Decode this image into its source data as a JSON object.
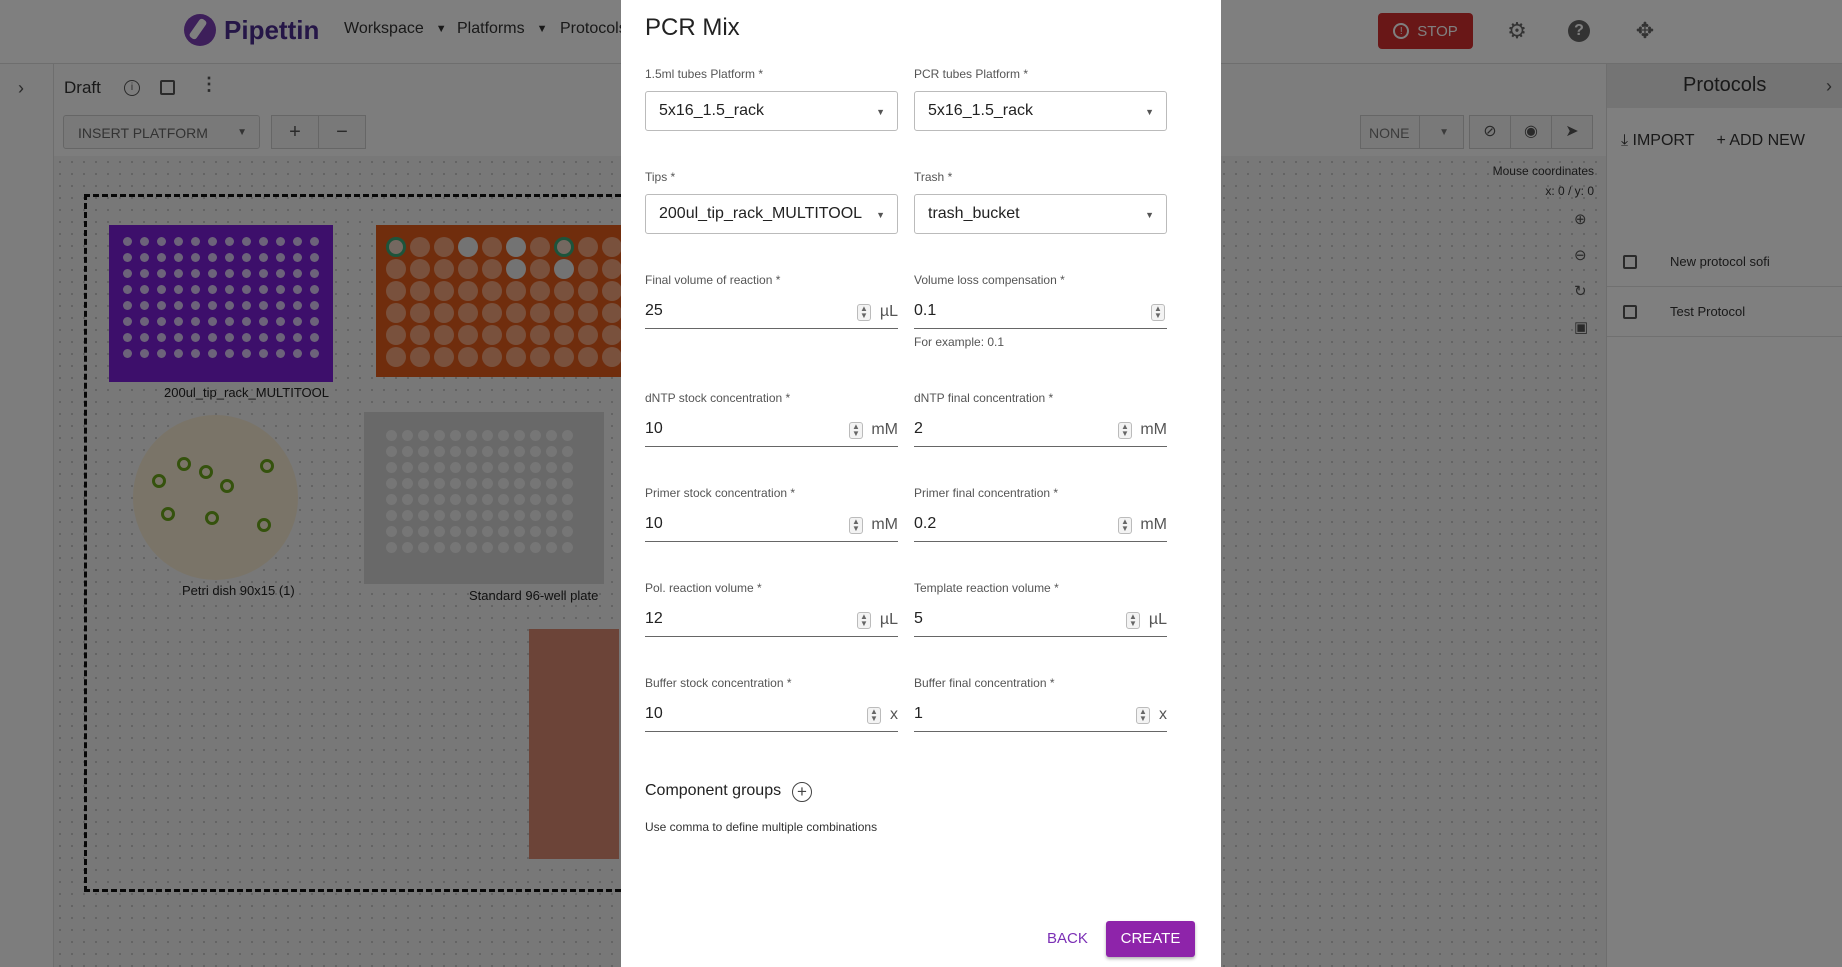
{
  "app": {
    "brand": "Pipettin",
    "nav": [
      "Workspace",
      "Platforms",
      "Protocols"
    ],
    "stop_label": "STOP"
  },
  "workspace": {
    "title": "Draft",
    "insert_platform_label": "INSERT PLATFORM",
    "plus_label": "+",
    "minus_label": "−",
    "selection_label": "NONE",
    "mouse_coords_label": "Mouse coordinates",
    "mouse_coords_value": "x: 0 / y: 0",
    "labware": [
      {
        "label": "200ul_tip_rack_MULTITOOL",
        "color": "#7b1fd6"
      },
      {
        "label": "Petri dish 90x15 (1)",
        "color": "#f4e9d0"
      },
      {
        "label": "Standard 96-well plate",
        "color": "#d3d3d3"
      },
      {
        "label": "",
        "color": "#e05a1a"
      },
      {
        "label": "",
        "color": "#d98870"
      }
    ]
  },
  "protocols_panel": {
    "title": "Protocols",
    "import_label": "IMPORT",
    "add_new_label": "ADD NEW",
    "items": [
      "New protocol sofi",
      "Test Protocol"
    ]
  },
  "modal": {
    "title": "PCR Mix",
    "tubes_platform": {
      "label": "1.5ml tubes Platform *",
      "value": "5x16_1.5_rack"
    },
    "pcr_tubes_platform": {
      "label": "PCR tubes Platform *",
      "value": "5x16_1.5_rack"
    },
    "tips": {
      "label": "Tips *",
      "value": "200ul_tip_rack_MULTITOOL"
    },
    "trash": {
      "label": "Trash *",
      "value": "trash_bucket"
    },
    "final_volume": {
      "label": "Final volume of reaction *",
      "value": "25",
      "unit": "µL"
    },
    "volume_loss": {
      "label": "Volume loss compensation *",
      "value": "0.1",
      "helper": "For example: 0.1"
    },
    "dntp_stock": {
      "label": "dNTP stock concentration *",
      "value": "10",
      "unit": "mM"
    },
    "dntp_final": {
      "label": "dNTP final concentration *",
      "value": "2",
      "unit": "mM"
    },
    "primer_stock": {
      "label": "Primer stock concentration *",
      "value": "10",
      "unit": "mM"
    },
    "primer_final": {
      "label": "Primer final concentration *",
      "value": "0.2",
      "unit": "mM"
    },
    "pol_volume": {
      "label": "Pol. reaction volume *",
      "value": "12",
      "unit": "µL"
    },
    "template_volume": {
      "label": "Template reaction volume *",
      "value": "5",
      "unit": "µL"
    },
    "buffer_stock": {
      "label": "Buffer stock concentration *",
      "value": "10",
      "unit": "x"
    },
    "buffer_final": {
      "label": "Buffer final concentration *",
      "value": "1",
      "unit": "x"
    },
    "component_groups_title": "Component groups",
    "component_groups_hint": "Use comma to define multiple combinations",
    "back_label": "BACK",
    "create_label": "CREATE"
  }
}
